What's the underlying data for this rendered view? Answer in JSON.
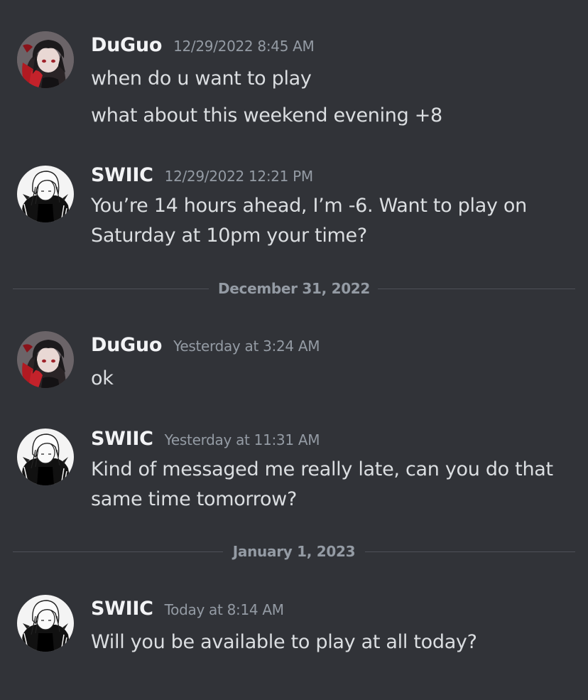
{
  "messages": [
    {
      "author": "DuGuo",
      "timestamp": "12/29/2022 8:45 AM",
      "lines": [
        "when do u want to play",
        "what about this weekend evening +8"
      ]
    },
    {
      "author": "SWIIC",
      "timestamp": "12/29/2022 12:21 PM",
      "lines": [
        "You’re 14 hours ahead, I’m -6. Want to play on Saturday at 10pm your time?"
      ]
    },
    {
      "author": "DuGuo",
      "timestamp": "Yesterday at 3:24 AM",
      "lines": [
        "ok"
      ]
    },
    {
      "author": "SWIIC",
      "timestamp": "Yesterday at 11:31 AM",
      "lines": [
        "Kind of messaged me really late, can you do that same time tomorrow?"
      ]
    },
    {
      "author": "SWIIC",
      "timestamp": "Today at 8:14 AM",
      "lines": [
        "Will you be available to play at all today?"
      ]
    }
  ],
  "dividers": [
    "December 31, 2022",
    "January 1, 2023"
  ],
  "colors": {
    "background": "#313338",
    "username": "#f2f3f5",
    "text": "#dbdee1",
    "muted": "#949ba4",
    "divider_line": "#4e5058"
  },
  "icons": {
    "duguo_avatar": "anime-avatar-dark-hair-red-scarf",
    "swiic_avatar": "anime-avatar-white-hair-monochrome"
  }
}
